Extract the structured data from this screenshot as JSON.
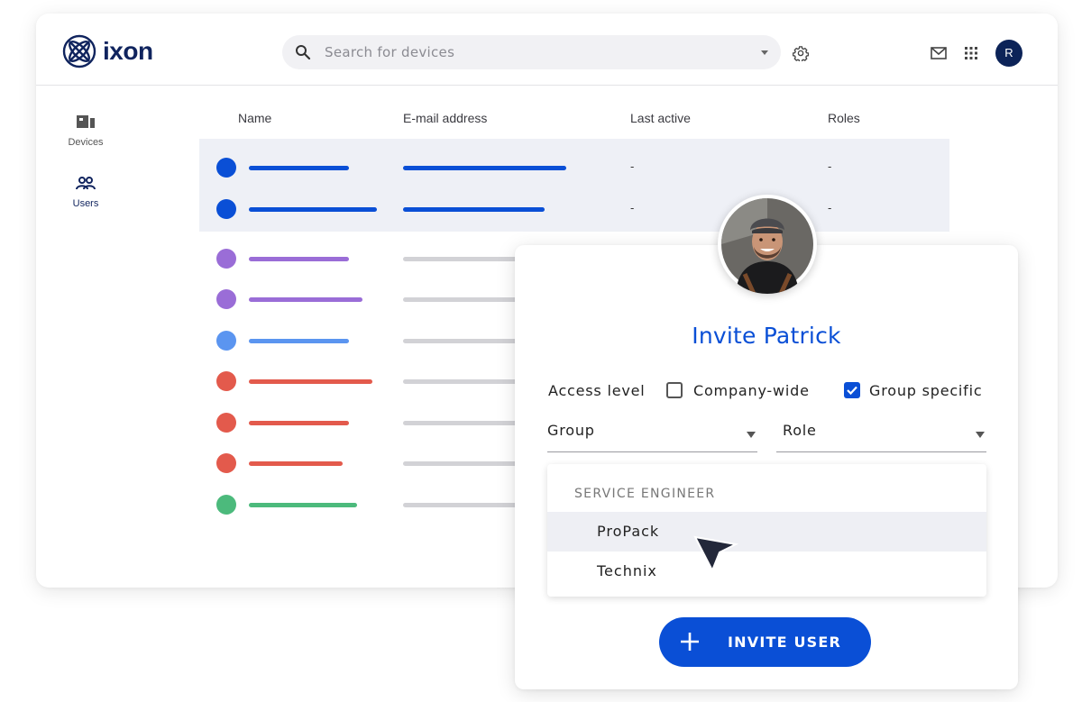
{
  "brand": {
    "name": "ixon"
  },
  "search": {
    "placeholder": "Search for devices"
  },
  "header": {
    "avatar_initial": "R"
  },
  "sidebar": {
    "items": [
      {
        "label": "Devices",
        "icon": "devices-icon"
      },
      {
        "label": "Users",
        "icon": "users-icon",
        "active": true
      }
    ]
  },
  "table": {
    "columns": [
      "Name",
      "E-mail address",
      "Last active",
      "Roles"
    ],
    "rows": [
      {
        "color": "#0a4fd6",
        "last_active": "-",
        "roles": "-"
      },
      {
        "color": "#0a4fd6",
        "last_active": "-",
        "roles": "-"
      },
      {
        "color": "#9a6dd7"
      },
      {
        "color": "#9a6dd7"
      },
      {
        "color": "#5b95f0"
      },
      {
        "color": "#e35a4c"
      },
      {
        "color": "#e35a4c"
      },
      {
        "color": "#e35a4c"
      },
      {
        "color": "#4cba7c"
      }
    ]
  },
  "invite": {
    "title": "Invite Patrick",
    "access_label": "Access level",
    "options": [
      {
        "label": "Company-wide",
        "checked": false
      },
      {
        "label": "Group specific",
        "checked": true
      }
    ],
    "group_label": "Group",
    "role_label": "Role",
    "dropdown": {
      "header": "SERVICE ENGINEER",
      "items": [
        {
          "label": "ProPack",
          "selected": true
        },
        {
          "label": "Technix",
          "selected": false
        }
      ]
    },
    "button_label": "INVITE USER"
  },
  "colors": {
    "accent": "#0a4fd6",
    "navy": "#10245e",
    "muted_bar": "#d2d2d6"
  }
}
